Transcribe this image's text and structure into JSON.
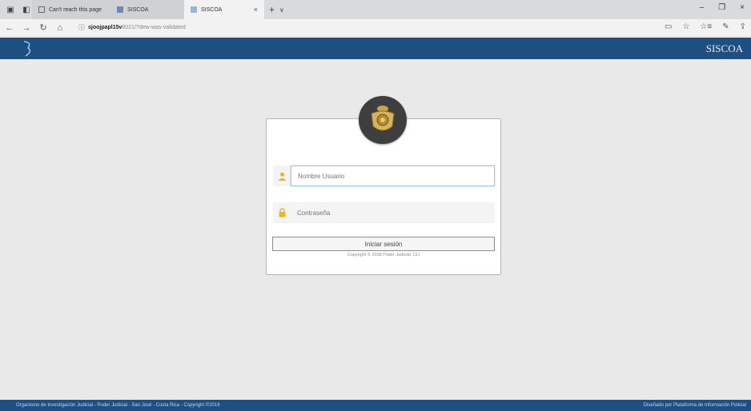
{
  "browser": {
    "tabs": [
      {
        "label": "Can't reach this page"
      },
      {
        "label": "SISCOA"
      },
      {
        "label": "SISCOA",
        "close": "×"
      }
    ],
    "new_tab": "+",
    "tab_dropdown": "∨",
    "window_controls": [
      "–",
      "❐",
      "×"
    ],
    "nav": {
      "back": "←",
      "forward": "→",
      "refresh": "↻",
      "home": "⌂"
    },
    "url": {
      "host": "sjoojpapl15v",
      "path": "8021/?dew-was-validated"
    },
    "addr_icons": [
      "▭",
      "☆",
      "☆≡",
      "✎",
      "⇪"
    ]
  },
  "app": {
    "brand": "SISCOA"
  },
  "login": {
    "username_placeholder": "Nombre Usuario",
    "password_placeholder": "Contraseña",
    "submit_label": "Iniciar sesión",
    "copyright": "Copyright © 2018 Poder Judicial, CIJ"
  },
  "footer": {
    "left": "Organismo de Investigación Judicial - Poder Judicial - San José - Costa Rica - Copyright ©2019",
    "right": "Diseñado por Plataforma de Información Policial"
  },
  "colors": {
    "header": "#1e4f82",
    "icon_accent": "#f0b321",
    "background": "#e9e9e9"
  }
}
